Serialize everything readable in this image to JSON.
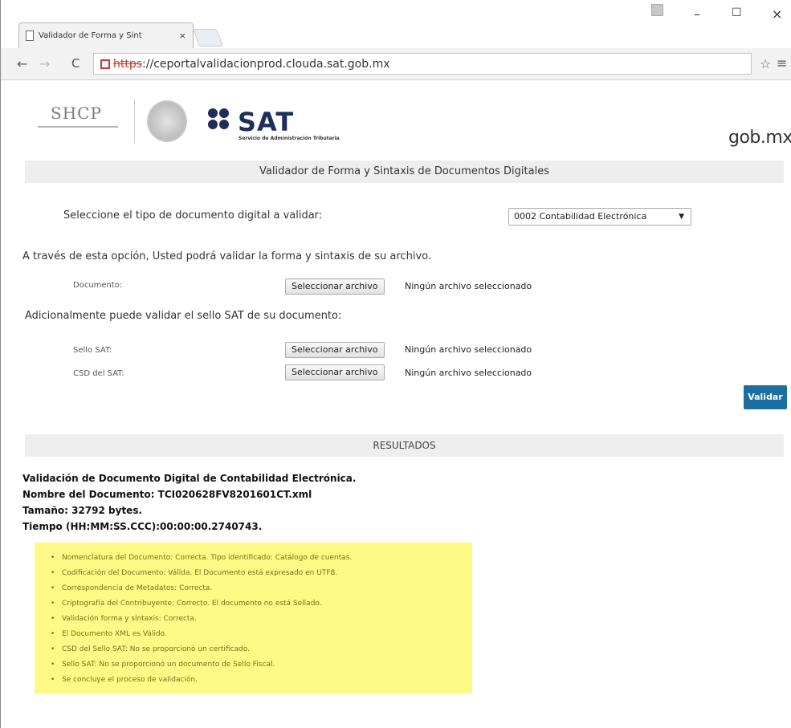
{
  "browser": {
    "tab_title": "Validador de Forma y Sint",
    "tab_close": "×",
    "url_protocol": "https",
    "url_rest": "://ceportalvalidacionprod.clouda.sat.gob.mx",
    "window_min": "–",
    "window_max": "☐",
    "window_close": "×",
    "back": "←",
    "forward": "→",
    "reload": "C",
    "star": "☆",
    "menu": "≡"
  },
  "header": {
    "shcp": "SHCP",
    "sat": "SAT",
    "sat_subtitle": "Servicio de Administración Tributaria",
    "gobmx": "gob.mx"
  },
  "page": {
    "title": "Validador de Forma y Sintaxis de Documentos Digitales",
    "doctype_label": "Seleccione el tipo de documento digital a validar:",
    "doctype_selected": "0002 Contabilidad Electrónica",
    "through_text": "A través de esta opción, Usted podrá validar la forma y sintaxis de su archivo.",
    "doc_label": "Documento:",
    "file_button": "Seleccionar archivo",
    "no_file": "Ningún archivo seleccionado",
    "additional_text": "Adicionalmente puede validar el sello SAT de su documento:",
    "sello_label": "Sello SAT:",
    "csd_label": "CSD del SAT:",
    "validar": "Validar",
    "results_title": "RESULTADOS"
  },
  "results": {
    "line1": "Validación de Documento Digital de Contabilidad Electrónica.",
    "line2": "Nombre del Documento: TCI020628FV8201601CT.xml",
    "line3": "Tamaño: 32792 bytes.",
    "line4": "Tiempo (HH:MM:SS.CCC):00:00:00.2740743."
  },
  "checks": [
    "Nomenclatura del Documento: Correcta. Tipo identificado: Catálogo de cuentas.",
    "Codificación del Documento: Válida. El Documento está expresado en UTF8.",
    "Correspondencia de Metadatos: Correcta.",
    "Criptografía del Contribuyente: Correcto. El documento no está Sellado.",
    "Validación forma y sintaxis: Correcta.",
    "El Documento XML es Válido.",
    "CSD del Sello SAT: No se proporcionó un certificado.",
    "Sello SAT: No se proporcionó un documento de Sello Fiscal.",
    "Se concluye el proceso de validación."
  ],
  "colors": {
    "sat_navy": "#1f2d5a",
    "button_blue": "#1c6fa0",
    "checks_bg": "#fffa86"
  }
}
